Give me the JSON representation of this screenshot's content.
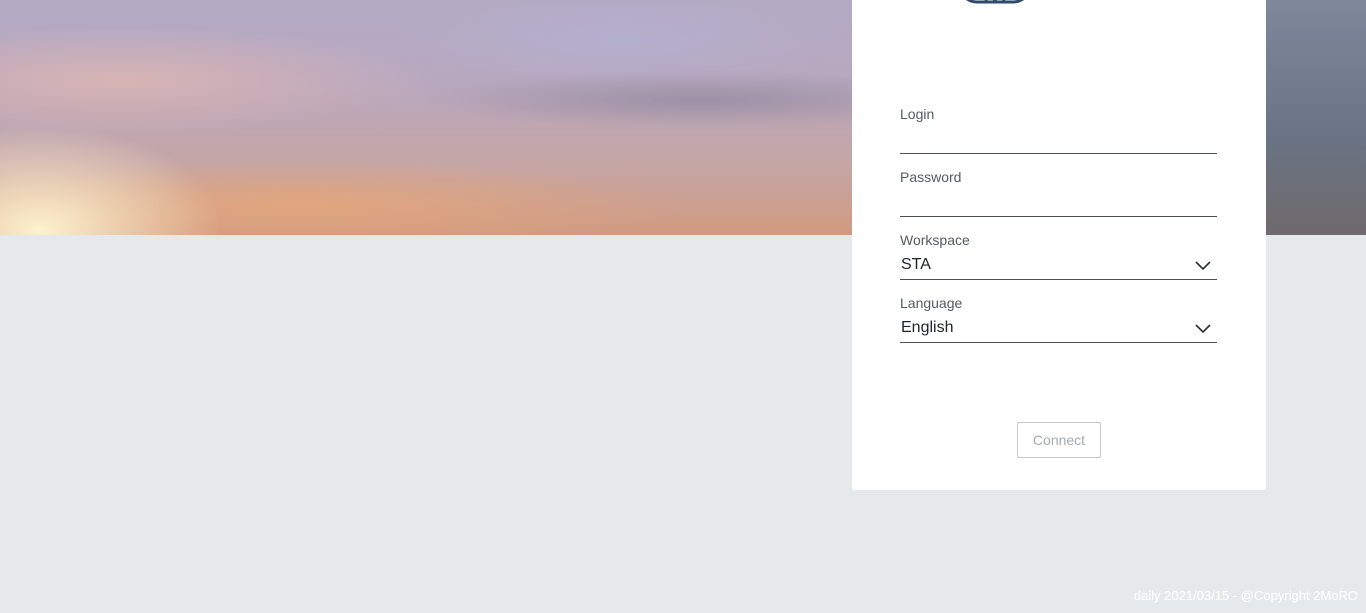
{
  "form": {
    "login": {
      "label": "Login",
      "value": ""
    },
    "password": {
      "label": "Password",
      "value": ""
    },
    "workspace": {
      "label": "Workspace",
      "selected": "STA"
    },
    "language": {
      "label": "Language",
      "selected": "English"
    },
    "connect_label": "Connect"
  },
  "footer": {
    "text": "daily 2021/03/15 - @Copyright 2MoRO"
  },
  "icons": {
    "logo": "gear-logo-icon",
    "workspace_dropdown": "chevron-down-icon",
    "language_dropdown": "chevron-down-icon"
  },
  "colors": {
    "page_background": "#e6e9ec",
    "card_background": "#ffffff",
    "logo": "#2f4a6b",
    "button_text_disabled": "#a6aaae"
  }
}
